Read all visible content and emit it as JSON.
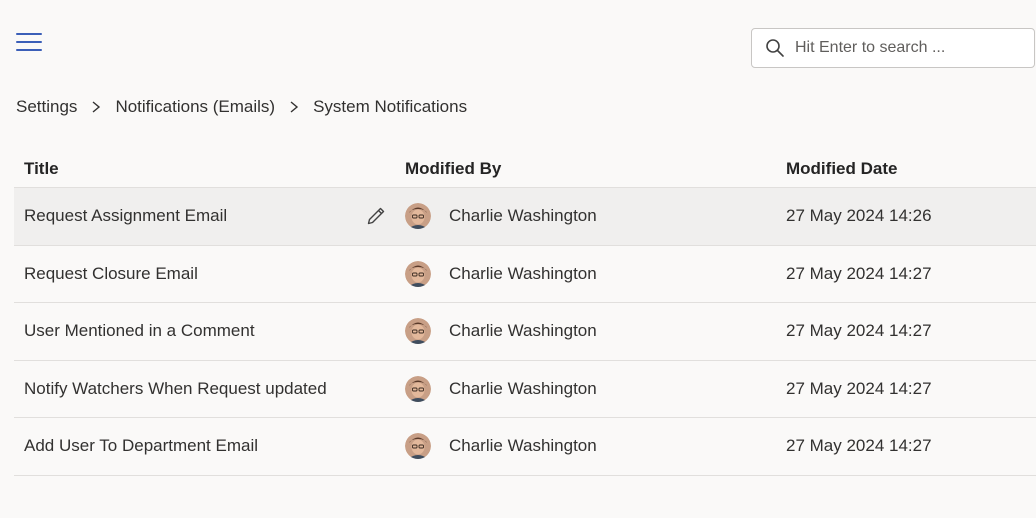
{
  "search": {
    "placeholder": "Hit Enter to search ..."
  },
  "breadcrumb": [
    "Settings",
    "Notifications (Emails)",
    "System Notifications"
  ],
  "table": {
    "headers": {
      "title": "Title",
      "modified_by": "Modified By",
      "modified_date": "Modified Date"
    },
    "rows": [
      {
        "title": "Request Assignment Email",
        "modified_by": "Charlie Washington",
        "modified_date": "27 May 2024 14:26"
      },
      {
        "title": "Request Closure Email",
        "modified_by": "Charlie Washington",
        "modified_date": "27 May 2024 14:27"
      },
      {
        "title": "User Mentioned in a Comment",
        "modified_by": "Charlie Washington",
        "modified_date": "27 May 2024 14:27"
      },
      {
        "title": "Notify Watchers When Request updated",
        "modified_by": "Charlie Washington",
        "modified_date": "27 May 2024 14:27"
      },
      {
        "title": "Add User To Department Email",
        "modified_by": "Charlie Washington",
        "modified_date": "27 May 2024 14:27"
      }
    ]
  },
  "icons": {
    "menu": "hamburger-menu-icon",
    "search": "search-icon",
    "separator": "chevron-right-icon",
    "edit": "pencil-edit-icon"
  },
  "colors": {
    "accent": "#3b5fb8",
    "background": "#faf9f8",
    "row_hover": "#f0efee",
    "divider": "#e1dfdd"
  }
}
